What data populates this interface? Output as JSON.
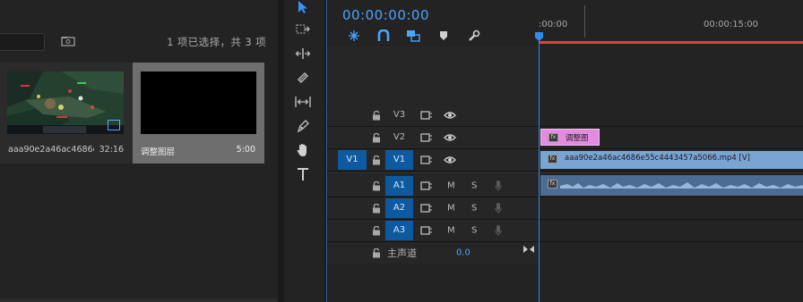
{
  "project": {
    "selection_count": "1 项已选择，共 3 项",
    "clips": [
      {
        "name": "aaa90e2a46ac4686e5...",
        "duration": "32:16"
      },
      {
        "name": "调整图层",
        "duration": "5:00"
      }
    ]
  },
  "timeline": {
    "timecode": "00:00:00:00",
    "ruler_labels": [
      ":00:00",
      "00:00:15:00"
    ],
    "tracks": {
      "v3": "V3",
      "v2": "V2",
      "v1": "V1",
      "v1_source": "V1",
      "a1": "A1",
      "a2": "A2",
      "a3": "A3",
      "mute": "M",
      "solo": "S"
    },
    "adjustment_clip": "调整图",
    "video_clip": "aaa90e2a46ac4686e55c4443457a5066.mp4 [V]",
    "fx_badge": "fx",
    "master_label": "主声道",
    "master_value": "0.0"
  },
  "colors": {
    "accent": "#4aa3ff",
    "track_target": "#0e5aa0",
    "video_clip": "#7aa4d3",
    "adjustment_clip": "#e28ce0",
    "audio_clip": "#4b6c93",
    "work_area": "#e03d3d"
  },
  "icons": {
    "tools": [
      "selection-tool-icon",
      "track-select-forward-icon",
      "ripple-edit-icon",
      "razor-icon",
      "slip-icon",
      "pen-icon",
      "hand-icon",
      "type-icon"
    ],
    "timeline_tools": [
      "nest-sequence-icon",
      "snap-icon",
      "linked-selection-icon",
      "add-marker-icon",
      "timeline-settings-icon"
    ]
  }
}
